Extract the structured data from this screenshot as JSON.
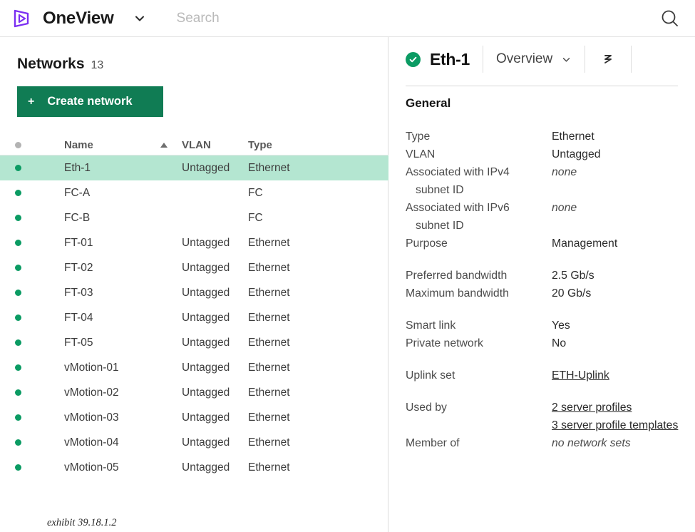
{
  "topbar": {
    "brand": "OneView",
    "logo_icon": "oneview-logo-icon",
    "caret_icon": "chevron-down-icon",
    "search_placeholder": "Search",
    "search_icon": "search-icon"
  },
  "left_panel": {
    "title": "Networks",
    "count": "13",
    "create_button": {
      "plus": "+",
      "label": "Create network"
    },
    "columns": {
      "status": "",
      "name": "Name",
      "sort_icon": "sort-ascending-icon",
      "vlan": "VLAN",
      "type": "Type"
    },
    "rows": [
      {
        "status": "ok",
        "name": "Eth-1",
        "vlan": "Untagged",
        "type": "Ethernet",
        "selected": true
      },
      {
        "status": "ok",
        "name": "FC-A",
        "vlan": "",
        "type": "FC",
        "selected": false
      },
      {
        "status": "ok",
        "name": "FC-B",
        "vlan": "",
        "type": "FC",
        "selected": false
      },
      {
        "status": "ok",
        "name": "FT-01",
        "vlan": "Untagged",
        "type": "Ethernet",
        "selected": false
      },
      {
        "status": "ok",
        "name": "FT-02",
        "vlan": "Untagged",
        "type": "Ethernet",
        "selected": false
      },
      {
        "status": "ok",
        "name": "FT-03",
        "vlan": "Untagged",
        "type": "Ethernet",
        "selected": false
      },
      {
        "status": "ok",
        "name": "FT-04",
        "vlan": "Untagged",
        "type": "Ethernet",
        "selected": false
      },
      {
        "status": "ok",
        "name": "FT-05",
        "vlan": "Untagged",
        "type": "Ethernet",
        "selected": false
      },
      {
        "status": "ok",
        "name": "vMotion-01",
        "vlan": "Untagged",
        "type": "Ethernet",
        "selected": false
      },
      {
        "status": "ok",
        "name": "vMotion-02",
        "vlan": "Untagged",
        "type": "Ethernet",
        "selected": false
      },
      {
        "status": "ok",
        "name": "vMotion-03",
        "vlan": "Untagged",
        "type": "Ethernet",
        "selected": false
      },
      {
        "status": "ok",
        "name": "vMotion-04",
        "vlan": "Untagged",
        "type": "Ethernet",
        "selected": false
      },
      {
        "status": "ok",
        "name": "vMotion-05",
        "vlan": "Untagged",
        "type": "Ethernet",
        "selected": false
      }
    ],
    "exhibit_caption": "exhibit 39.18.1.2"
  },
  "right_panel": {
    "status_icon": "check-circle-icon",
    "title": "Eth-1",
    "view": "Overview",
    "view_caret_icon": "chevron-down-icon",
    "actions_icon": "actions-zigzag-icon",
    "section_title": "General",
    "fields": {
      "type_label": "Type",
      "type_value": "Ethernet",
      "vlan_label": "VLAN",
      "vlan_value": "Untagged",
      "ipv4_label_line1": "Associated with IPv4",
      "ipv4_label_line2": "subnet ID",
      "ipv4_value": "none",
      "ipv6_label_line1": "Associated with IPv6",
      "ipv6_label_line2": "subnet ID",
      "ipv6_value": "none",
      "purpose_label": "Purpose",
      "purpose_value": "Management",
      "preferred_bw_label": "Preferred bandwidth",
      "preferred_bw_value": "2.5 Gb/s",
      "maximum_bw_label": "Maximum bandwidth",
      "maximum_bw_value": "20 Gb/s",
      "smart_link_label": "Smart link",
      "smart_link_value": "Yes",
      "private_network_label": "Private network",
      "private_network_value": "No",
      "uplink_set_label": "Uplink set",
      "uplink_set_value": "ETH-Uplink",
      "used_by_label": "Used by",
      "used_by_value_1": "2 server profiles",
      "used_by_value_2": "3 server profile templates",
      "member_of_label": "Member of",
      "member_of_value": "no network sets"
    }
  },
  "colors": {
    "brand_purple": "#7b2ff2",
    "green_button": "#107c54",
    "status_green": "#0b9b63",
    "selection_mint": "#b4e6d1"
  }
}
